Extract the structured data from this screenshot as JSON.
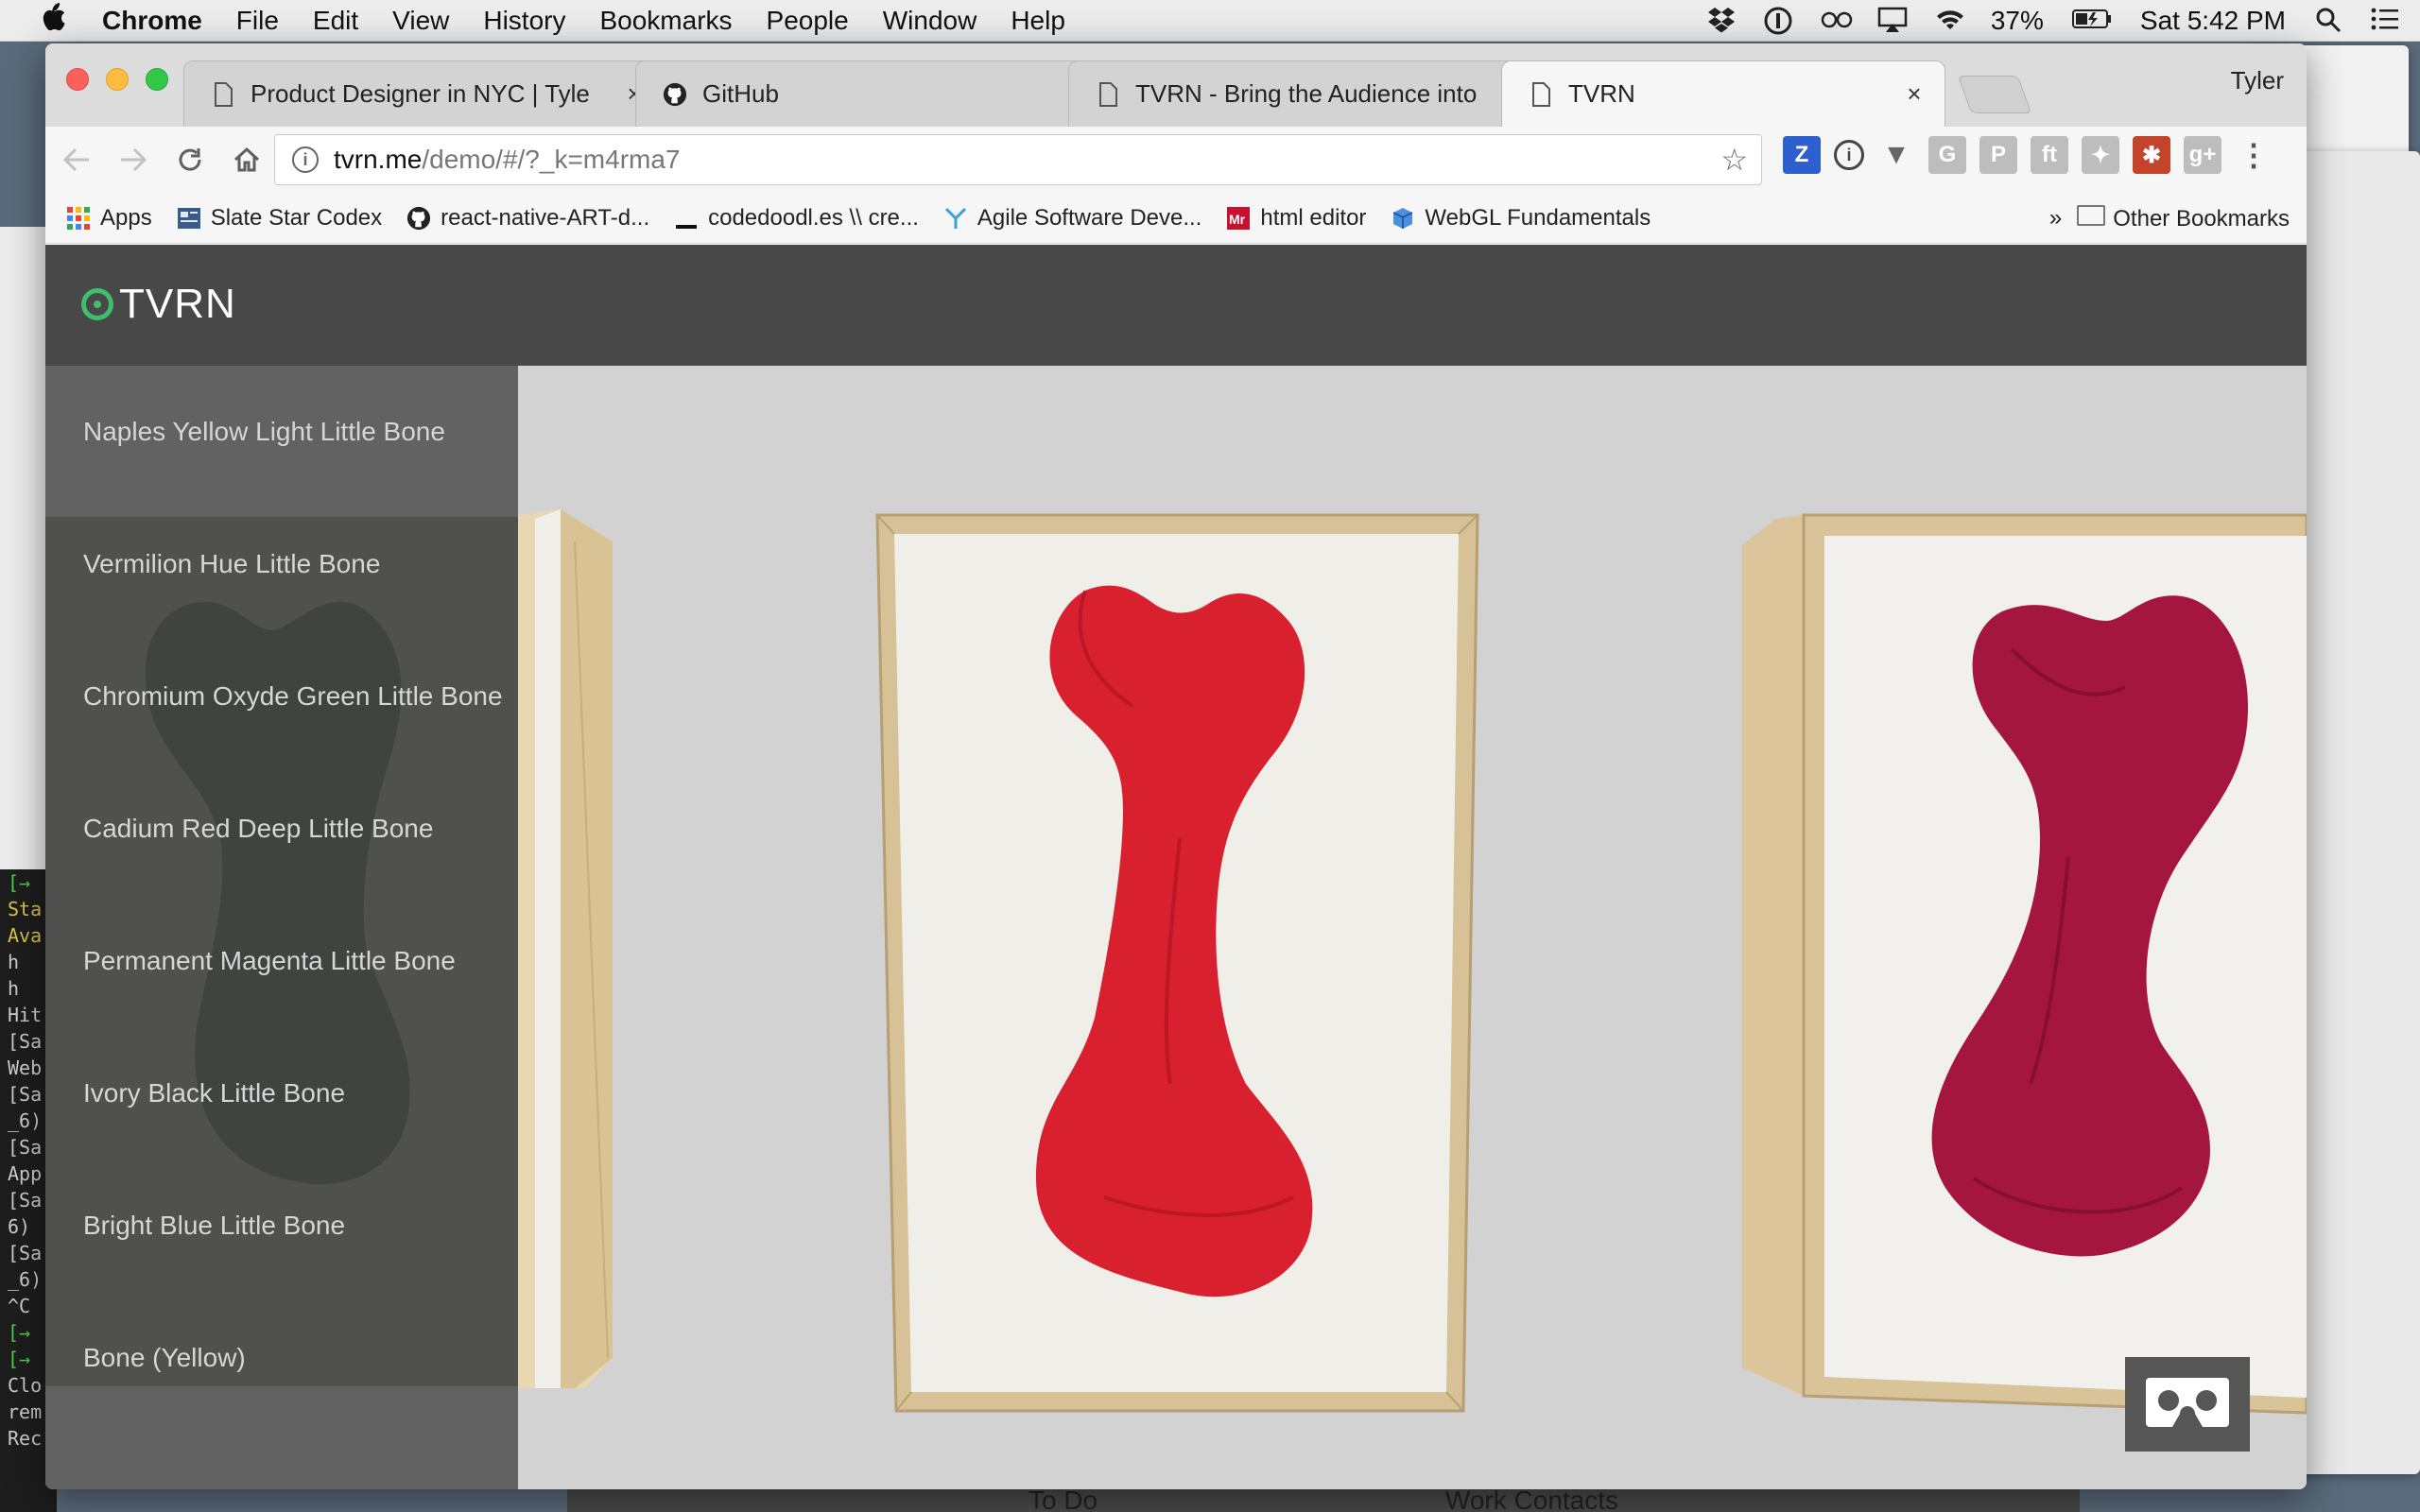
{
  "menubar": {
    "app": "Chrome",
    "items": [
      "File",
      "Edit",
      "View",
      "History",
      "Bookmarks",
      "People",
      "Window",
      "Help"
    ],
    "battery": "37%",
    "clock": "Sat 5:42 PM"
  },
  "tabs": [
    {
      "title": "Product Designer in NYC | Tyle",
      "icon": "page-icon",
      "close": "×"
    },
    {
      "title": "GitHub",
      "icon": "github-icon",
      "close": "×"
    },
    {
      "title": "TVRN - Bring the Audience into",
      "icon": "page-icon",
      "close": "×"
    },
    {
      "title": "TVRN",
      "icon": "page-icon",
      "close": "×"
    }
  ],
  "profile": "Tyler",
  "omnibox": {
    "host": "tvrn.me",
    "path": "/demo/#/?_k=m4rma7"
  },
  "bookmarks": [
    {
      "label": "Apps",
      "icon": "apps-grid-icon"
    },
    {
      "label": "Slate Star Codex",
      "icon": "slate-icon"
    },
    {
      "label": "react-native-ART-d...",
      "icon": "github-icon"
    },
    {
      "label": "codedoodl.es \\\\ cre...",
      "icon": "underscore-icon"
    },
    {
      "label": "Agile Software Deve...",
      "icon": "agile-icon"
    },
    {
      "label": "html editor",
      "icon": "mr-icon"
    },
    {
      "label": "WebGL Fundamentals",
      "icon": "cube-icon"
    }
  ],
  "bookmarks_overflow": "»",
  "other_bookmarks": "Other Bookmarks",
  "site": {
    "logo": "TVRN",
    "menu": [
      "Naples Yellow Light Little Bone",
      "Vermilion Hue Little Bone",
      "Chromium Oxyde Green Little Bone",
      "Cadium Red Deep Little Bone",
      "Permanent Magenta Little Bone",
      "Ivory Black Little Bone",
      "Bright Blue Little Bone",
      "Bone (Yellow)"
    ]
  },
  "colors": {
    "header": "#484848",
    "logo_accent": "#3fbf6b",
    "bone_red": "#d8202e",
    "bone_magenta": "#a5163f",
    "bone_green": "#2f3b33"
  },
  "terminal": [
    "Sta",
    "Ava",
    "h",
    "h",
    "Hit",
    "[Sa",
    "Web",
    "[Sa",
    "_6)",
    "[Sa",
    "App",
    "[Sa",
    "6)",
    "[Sa",
    "_6)",
    "^C",
    "",
    "",
    "Clo",
    "rem",
    "Rec"
  ],
  "dock": {
    "left_label": "To Do",
    "right_label": "Work Contacts"
  }
}
